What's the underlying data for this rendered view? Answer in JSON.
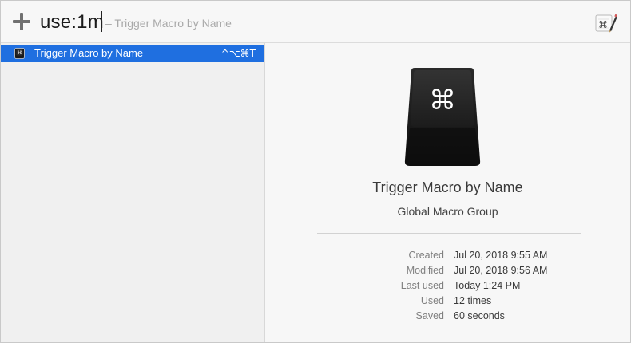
{
  "search": {
    "query": "use:1m",
    "hint": "– Trigger Macro by Name"
  },
  "toolbar": {
    "add_icon": "plus-icon",
    "editor_icon": "editor-icon",
    "editor_glyph": "⌘"
  },
  "results": [
    {
      "label": "Trigger Macro by Name",
      "shortcut": "^⌥⌘T",
      "icon": "command-key-icon",
      "selected": true
    }
  ],
  "detail": {
    "keycap_glyph": "⌘",
    "name": "Trigger Macro by Name",
    "group": "Global Macro Group",
    "info": [
      {
        "label": "Created",
        "value": "Jul 20, 2018 9:55 AM"
      },
      {
        "label": "Modified",
        "value": "Jul 20, 2018 9:56 AM"
      },
      {
        "label": "Last used",
        "value": "Today 1:24 PM"
      },
      {
        "label": "Used",
        "value": "12 times"
      },
      {
        "label": "Saved",
        "value": "60 seconds"
      }
    ]
  },
  "colors": {
    "selection": "#1f6fe0",
    "sidebar_bg": "#f0f0f0",
    "detail_bg": "#f7f7f7",
    "keycap": "#1b1b1b"
  }
}
